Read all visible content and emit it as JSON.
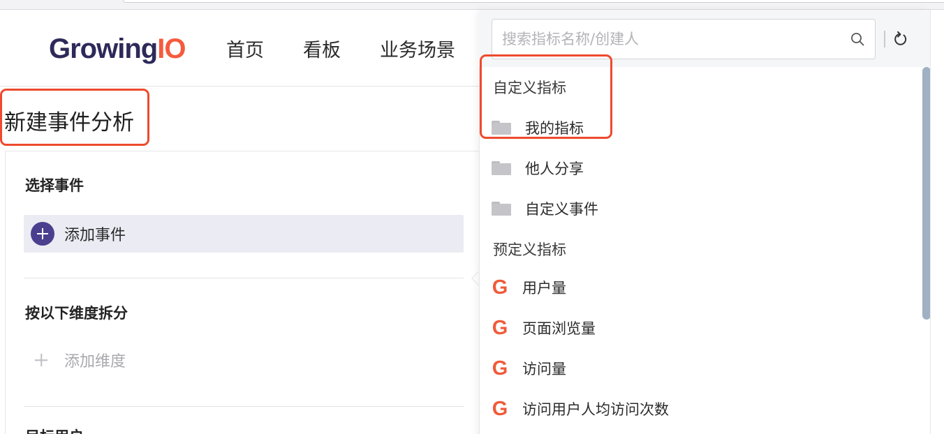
{
  "header": {
    "logo_main": "Growing",
    "logo_accent": "IO",
    "nav": [
      "首页",
      "看板",
      "业务场景"
    ]
  },
  "page_title": "新建事件分析",
  "panel": {
    "select_event_title": "选择事件",
    "add_event_label": "添加事件",
    "split_title": "按以下维度拆分",
    "add_dimension_label": "添加维度",
    "target_users_title": "目标用户"
  },
  "dropdown": {
    "search_placeholder": "搜索指标名称/创建人",
    "custom_group": "自定义指标",
    "custom_items": [
      "我的指标",
      "他人分享",
      "自定义事件"
    ],
    "preset_group": "预定义指标",
    "preset_items": [
      "用户量",
      "页面浏览量",
      "访问量",
      "访问用户人均访问次数"
    ],
    "preset_icon": "G"
  },
  "colors": {
    "brand": "#2d2a5a",
    "accent": "#f55a3c",
    "highlight": "#ee4a2e",
    "add_event_bg": "#ebebf3",
    "plus_circle": "#4a3f8f"
  }
}
